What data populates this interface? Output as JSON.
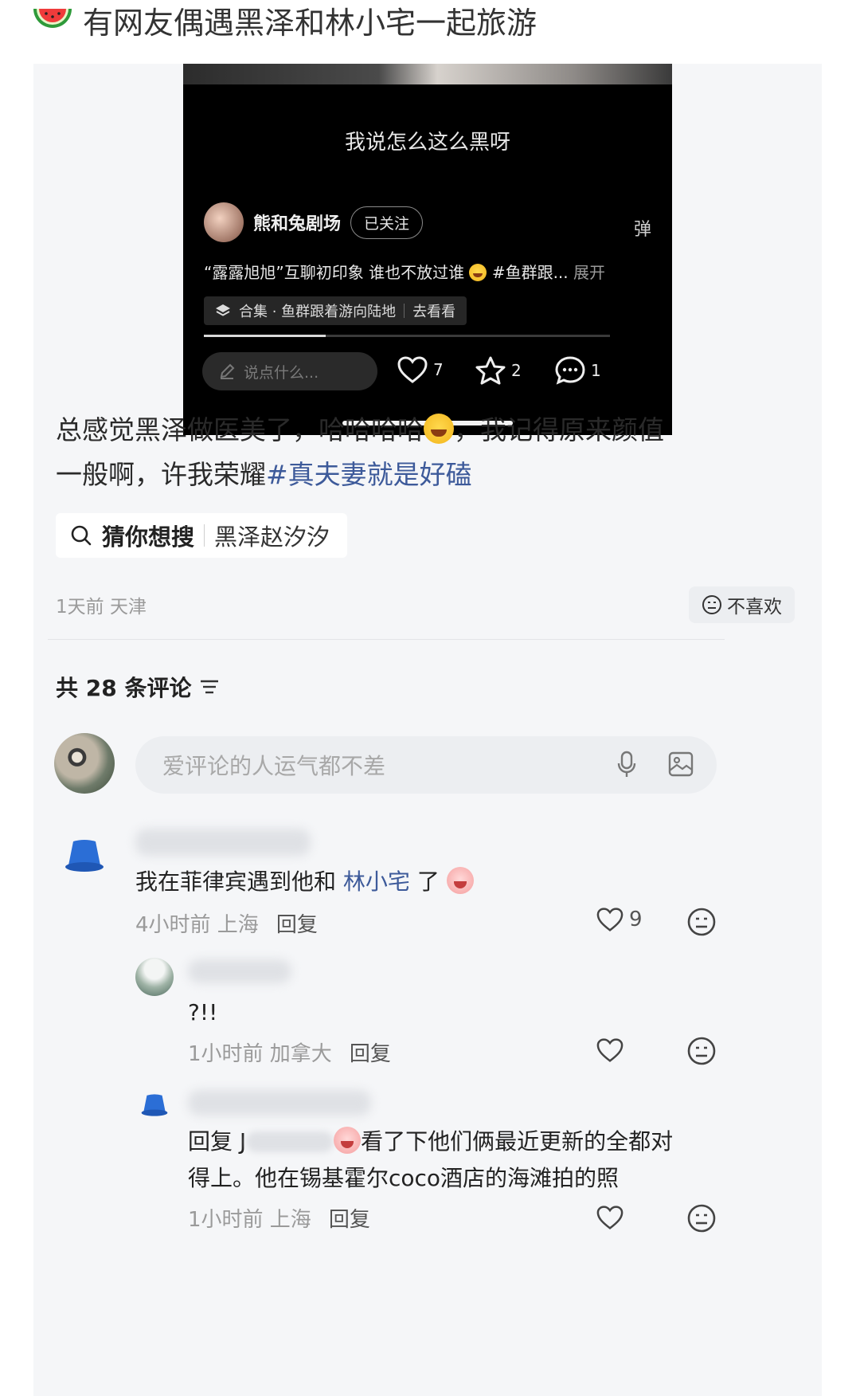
{
  "header": {
    "icon": "watermelon-icon",
    "title": "有网友偶遇黑泽和林小宅一起旅游"
  },
  "video": {
    "subtitle": "我说怎么这么黑呀",
    "author": "熊和兔剧场",
    "follow_label": "已关注",
    "danmu_label": "弹",
    "desc_before": "“露露旭旭”互聊初印象 谁也不放过谁",
    "desc_after": " #鱼群跟...",
    "desc_more": "展开",
    "collection_label": "合集 · 鱼群跟着游向陆地",
    "collection_action": "去看看",
    "progress_fraction": 0.3,
    "comment_placeholder": "说点什么...",
    "likes": "7",
    "favorites": "2",
    "comments": "1"
  },
  "post": {
    "text_line1_a": "总感觉黑泽做医美了，哈哈哈哈",
    "text_line1_b": "，我记得原来颜值",
    "text_line2": "一般啊，许我荣耀",
    "hashtag": "#真夫妻就是好磕"
  },
  "guess": {
    "label": "猜你想搜",
    "term": "黑泽赵汐汐"
  },
  "meta": {
    "time_location": "1天前 天津",
    "dislike_label": "不喜欢"
  },
  "comments_section": {
    "count_label": "共 28 条评论",
    "input_placeholder": "爱评论的人运气都不差"
  },
  "comments": [
    {
      "text_before": "我在菲律宾遇到他和 ",
      "mention": "林小宅",
      "text_after": " 了",
      "time_location": "4小时前 上海",
      "reply_label": "回复",
      "likes": "9"
    },
    {
      "text": "?!!",
      "time_location": "1小时前 加拿大",
      "reply_label": "回复"
    },
    {
      "line1_prefix": "回复 J",
      "line1_suffix": "看了下他们俩最近更新的全都对",
      "line2": "得上。他在锡基霍尔coco酒店的海滩拍的照",
      "time_location": "1小时前 上海",
      "reply_label": "回复"
    }
  ]
}
